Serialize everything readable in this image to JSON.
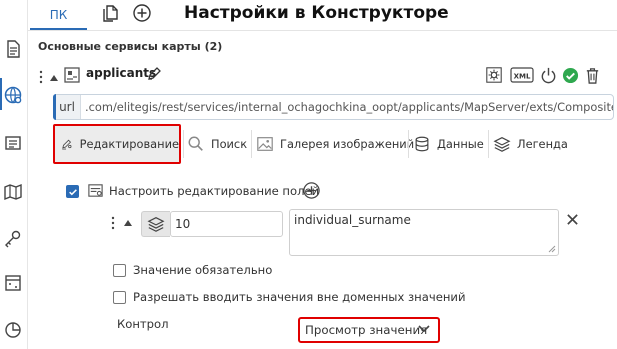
{
  "header": {
    "title": "Настройки в Конструкторе",
    "tab_pk": "ПК"
  },
  "section": {
    "title": "Основные сервисы карты (2)"
  },
  "service": {
    "name": "applicants",
    "url_label": "url",
    "url": ".com/elitegis/rest/services/internal_ochagochkina_oopt/applicants/MapServer/exts/CompositeSoe"
  },
  "tabs": [
    {
      "label": "Редактирование",
      "icon": "edit-map-icon",
      "active": true
    },
    {
      "label": "Поиск",
      "icon": "search-icon"
    },
    {
      "label": "Галерея изображений",
      "icon": "image-icon"
    },
    {
      "label": "Данные",
      "icon": "database-icon"
    },
    {
      "label": "Легенда",
      "icon": "layers-icon"
    }
  ],
  "editing": {
    "configure_label": "Настроить редактирование полей",
    "layer_number": "10",
    "field_name": "individual_surname",
    "required_label": "Значение обязательно",
    "allow_outside_label": "Разрешать вводить значения вне доменных значений",
    "control_label": "Контрол",
    "control_value": "Просмотр значения"
  },
  "colors": {
    "accent": "#2a6bb5",
    "highlight": "#e00000",
    "status_ok": "#2fa84f"
  }
}
